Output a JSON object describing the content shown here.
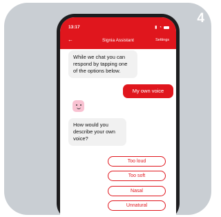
{
  "step": "4",
  "status_bar": {
    "time": "13:17"
  },
  "header": {
    "title": "Signia Assistant",
    "settings": "Settings"
  },
  "messages": {
    "intro": "While we chat you can respond by tapping one of the options below.",
    "user_reply": "My own voice",
    "question": "How would you describe your own voice?"
  },
  "options": [
    "Too loud",
    "Too soft",
    "Nasal",
    "Unnatural"
  ],
  "colors": {
    "accent": "#e0161d",
    "card": "#c9ced3",
    "avatar": "#f9c2d2"
  }
}
